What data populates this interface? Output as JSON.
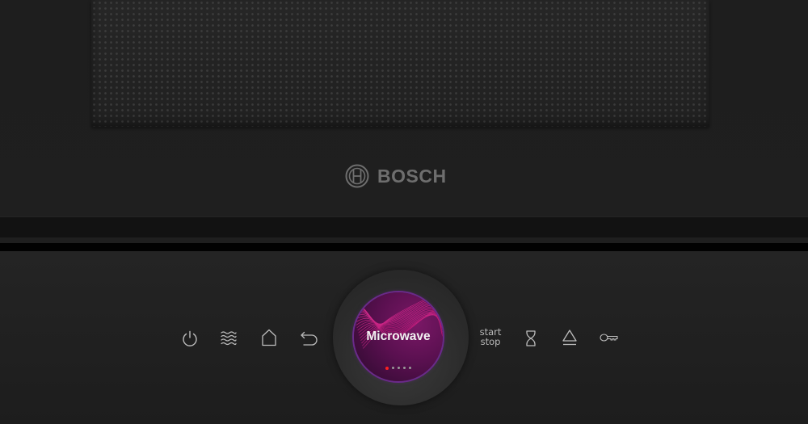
{
  "door": {
    "brand": "BOSCH",
    "brand_logo_icon": "bosch-armature-icon"
  },
  "control_panel": {
    "left_buttons": [
      {
        "name": "power",
        "icon": "power-icon"
      },
      {
        "name": "microwave-mode",
        "icon": "waves-icon"
      },
      {
        "name": "home",
        "icon": "home-icon"
      },
      {
        "name": "back",
        "icon": "back-arrow-icon"
      }
    ],
    "display": {
      "mode_label": "Microwave",
      "page_count": 5,
      "active_page": 1,
      "accent_color": "#c2187a",
      "active_dot_color": "#ff2020"
    },
    "start_stop": {
      "line1": "start",
      "line2": "stop"
    },
    "right_buttons": [
      {
        "name": "timer",
        "icon": "hourglass-icon"
      },
      {
        "name": "door-open",
        "icon": "eject-icon"
      },
      {
        "name": "child-lock",
        "icon": "key-icon"
      }
    ]
  }
}
